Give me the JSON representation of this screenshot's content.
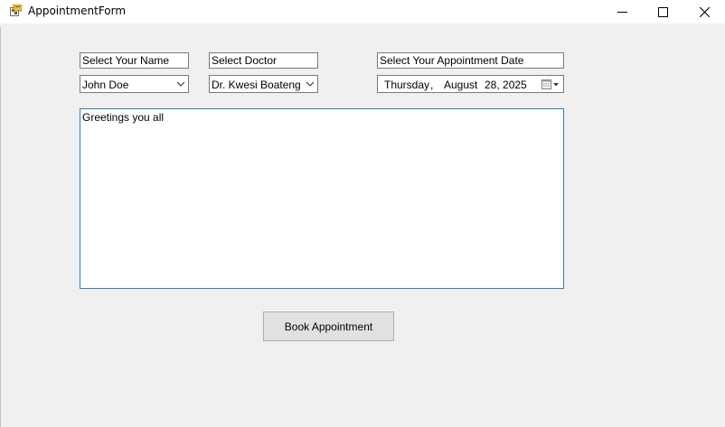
{
  "window": {
    "title": "AppointmentForm",
    "icon": "app-form-icon"
  },
  "labels": {
    "name_label": "Select Your Name",
    "doctor_label": "Select Doctor",
    "date_label": "Select Your Appointment Date"
  },
  "name_combo": {
    "selected": "John Doe"
  },
  "doctor_combo": {
    "selected": "Dr. Kwesi Boateng"
  },
  "date_picker": {
    "weekday": "Thursday",
    "comma": ",",
    "month": "August",
    "day_year": "28, 2025"
  },
  "message": {
    "text": "Greetings you all"
  },
  "book_button": {
    "label": "Book Appointment"
  },
  "colors": {
    "focus_border": "#2f7fb5",
    "button_face": "#e1e1e1",
    "form_bg": "#f0f0f0"
  }
}
